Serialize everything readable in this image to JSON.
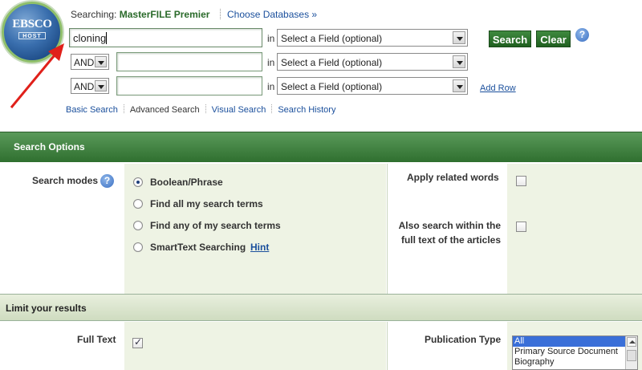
{
  "logo": {
    "top": "EBSCO",
    "bottom": "HOST"
  },
  "header": {
    "searching_label": "Searching:",
    "database": "MasterFILE Premier",
    "choose_link": "Choose Databases »"
  },
  "search": {
    "rows": [
      {
        "bool": "",
        "value": "cloning",
        "in_label": "in",
        "field": "Select a Field (optional)"
      },
      {
        "bool": "AND",
        "value": "",
        "in_label": "in",
        "field": "Select a Field (optional)"
      },
      {
        "bool": "AND",
        "value": "",
        "in_label": "in",
        "field": "Select a Field (optional)"
      }
    ],
    "search_button": "Search",
    "clear_button": "Clear",
    "help_glyph": "?",
    "add_row": "Add Row"
  },
  "nav_links": [
    "Basic Search",
    "Advanced Search",
    "Visual Search",
    "Search History"
  ],
  "search_options": {
    "title": "Search Options",
    "modes_label": "Search modes",
    "modes": [
      "Boolean/Phrase",
      "Find all my search terms",
      "Find any of my search terms",
      "SmartText Searching"
    ],
    "selected_mode": "Boolean/Phrase",
    "hint": "Hint",
    "related_words": "Apply related words",
    "full_text_search_line1": "Also search within the",
    "full_text_search_line2": "full text of the articles"
  },
  "limit": {
    "title": "Limit your results",
    "full_text_label": "Full Text",
    "full_text_checked": true,
    "pub_type_label": "Publication Type",
    "pub_types": [
      "All",
      "Primary Source Document",
      "Biography"
    ],
    "pub_type_selected": "All"
  },
  "colors": {
    "brand_green": "#2f6f2f",
    "link_blue": "#1a4f9c",
    "annotation_red": "#e0201a"
  }
}
